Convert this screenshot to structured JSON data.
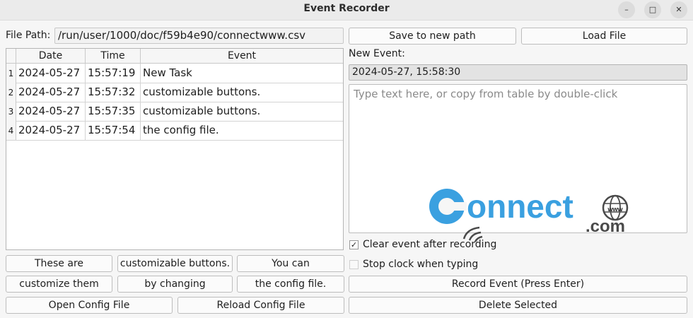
{
  "window": {
    "title": "Event Recorder",
    "minimize_glyph": "–",
    "maximize_glyph": "□",
    "close_glyph": "✕"
  },
  "file": {
    "label": "File Path:",
    "path": "/run/user/1000/doc/f59b4e90/connectwww.csv"
  },
  "buttons": {
    "save_new_path": "Save to new path",
    "load_file": "Load File",
    "record_event": "Record Event (Press Enter)",
    "delete_selected": "Delete Selected",
    "open_config": "Open Config File",
    "reload_config": "Reload Config File"
  },
  "custom_buttons": [
    "These are",
    "customizable buttons.",
    "You can",
    "customize them",
    "by changing",
    "the config file."
  ],
  "table": {
    "headers": [
      "Date",
      "Time",
      "Event"
    ],
    "rows": [
      {
        "num": "1",
        "date": "2024-05-27",
        "time": "15:57:19",
        "event": "New Task"
      },
      {
        "num": "2",
        "date": "2024-05-27",
        "time": "15:57:32",
        "event": "customizable buttons."
      },
      {
        "num": "3",
        "date": "2024-05-27",
        "time": "15:57:35",
        "event": "customizable buttons."
      },
      {
        "num": "4",
        "date": "2024-05-27",
        "time": "15:57:54",
        "event": "the config file."
      }
    ]
  },
  "new_event": {
    "label": "New Event:",
    "timestamp": "2024-05-27, 15:58:30",
    "placeholder": "Type text here, or copy from table by double-click"
  },
  "options": {
    "clear_event": {
      "label": "Clear event after recording",
      "checked": true,
      "mark": "✓"
    },
    "stop_clock": {
      "label": "Stop clock when typing",
      "checked": false
    }
  },
  "watermark": {
    "brand": "onnect",
    "tld": ".com",
    "www": "www",
    "color": "#3aa0e0"
  }
}
